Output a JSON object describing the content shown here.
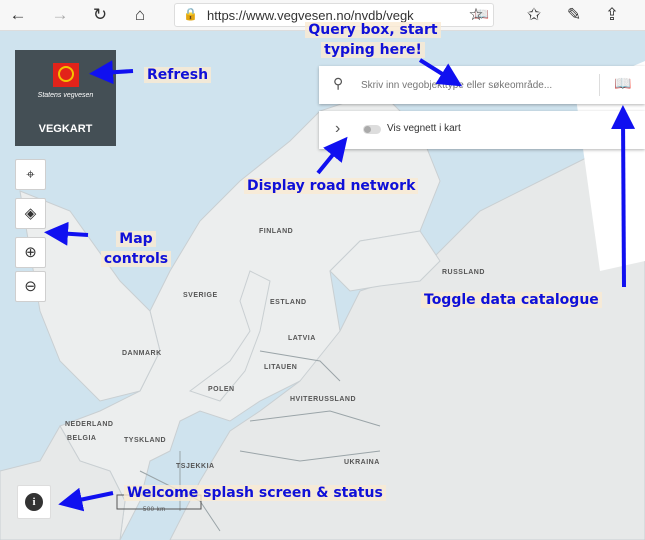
{
  "browser": {
    "url": "https://www.vegvesen.no/nvdb/vegk",
    "back_icon": "←",
    "forward_icon": "→",
    "reload_icon": "↻",
    "home_icon": "⌂",
    "lock_icon": "🔒",
    "reader_icon": "📖",
    "star_icon": "☆",
    "favorites_icon": "✩",
    "pen_icon": "✎",
    "share_icon": "⇪"
  },
  "logo": {
    "agency": "Statens vegvesen",
    "app_name": "VEGKART"
  },
  "controls": {
    "locate_icon": "⌖",
    "layers_icon": "◈",
    "zoom_in_icon": "⊕",
    "zoom_out_icon": "⊖"
  },
  "search": {
    "placeholder": "Skriv inn vegobjekttype eller søkeområde...",
    "search_icon": "⚲",
    "catalogue_icon": "📖"
  },
  "network": {
    "chevron": "›",
    "label": "Vis vegnett i kart"
  },
  "map_labels": {
    "finland": "FINLAND",
    "sverige": "SVERIGE",
    "estland": "ESTLAND",
    "latvia": "LATVIA",
    "litauen": "LITAUEN",
    "hviterussland": "HVITERUSSLAND",
    "russland": "RUSSLAND",
    "danmark": "DANMARK",
    "polen": "POLEN",
    "nederland": "NEDERLAND",
    "belgia": "BELGIA",
    "tyskland": "TYSKLAND",
    "tsjekkia": "TSJEKKIA",
    "ukraina": "UKRAINA",
    "scale": "500 km"
  },
  "info": {
    "icon": "i"
  },
  "annotations": {
    "refresh": "Refresh",
    "query_line1": "Query box, start",
    "query_line2": "typing here!",
    "display_road": "Display road network",
    "map_controls_line1": "Map",
    "map_controls_line2": "controls",
    "toggle_catalogue": "Toggle data catalogue",
    "welcome": "Welcome splash screen & status"
  }
}
